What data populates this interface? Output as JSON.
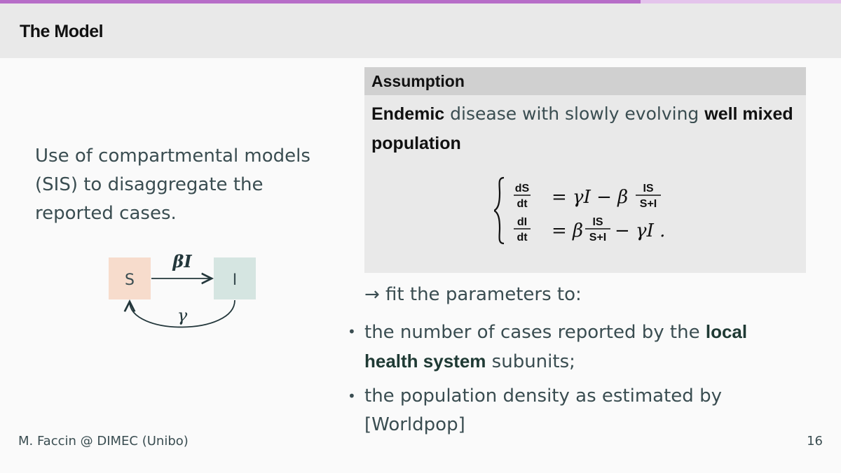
{
  "progress": 0.762,
  "colors": {
    "progress_fill": "#b76dc8",
    "progress_track": "#e4c4ec",
    "header_bg": "#e9e9e9",
    "block_title_bg": "#d0d0d0",
    "block_bg": "#e9e9e9",
    "susceptible_box": "#f7dccc",
    "infected_box": "#d5e5e1"
  },
  "header": {
    "title": "The Model"
  },
  "left": {
    "text": "Use of compartmental models (SIS) to disaggregate the reported cases."
  },
  "diagram": {
    "s_label": "S",
    "i_label": "I",
    "forward_rate": "βI",
    "back_rate": "γ"
  },
  "block": {
    "title": "Assumption",
    "bold1": "Endemic",
    "text1": " disease with slowly evolving ",
    "bold2": "well mixed population",
    "equations": {
      "eq1_lhs_num": "dS",
      "eq1_lhs_den": "dt",
      "eq1_rhs_a": "= γI − β",
      "eq1_frac_num": "IS",
      "eq1_frac_den": "S+I",
      "eq2_lhs_num": "dI",
      "eq2_lhs_den": "dt",
      "eq2_rhs_a": "= β",
      "eq2_frac_num": "IS",
      "eq2_frac_den": "S+I",
      "eq2_rhs_b": "− γI ."
    }
  },
  "fit_line": "→ fit the parameters to:",
  "items": [
    {
      "pre": "the number of cases reported by the ",
      "bold": "local health system",
      "post": " subunits;"
    },
    {
      "pre": "the population density as estimated by [Worldpop]",
      "bold": "",
      "post": ""
    }
  ],
  "footer": {
    "author": "M. Faccin @ DIMEC (Unibo)",
    "page": "16"
  }
}
